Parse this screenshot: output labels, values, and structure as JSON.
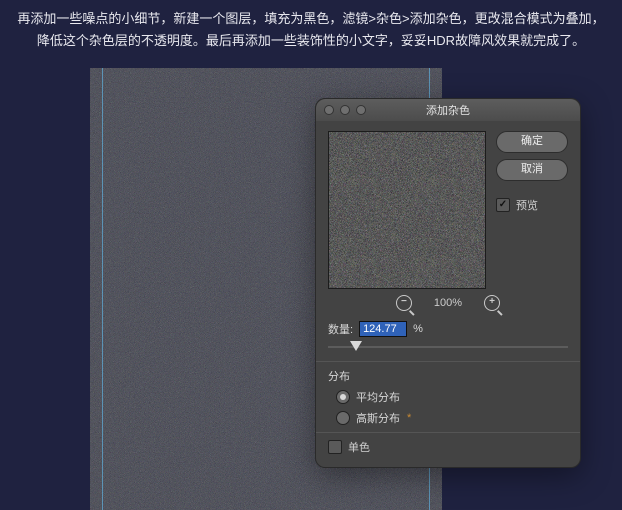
{
  "instructions": {
    "line1": "再添加一些噪点的小细节，新建一个图层，填充为黑色，滤镜>杂色>添加杂色，更改混合模式为叠加，",
    "line2": "降低这个杂色层的不透明度。最后再添加一些装饰性的小文字，妥妥HDR故障风效果就完成了。"
  },
  "dialog": {
    "title": "添加杂色",
    "ok_label": "确定",
    "cancel_label": "取消",
    "preview_label": "预览",
    "preview_checked": true,
    "zoom_value": "100%",
    "amount_label": "数量:",
    "amount_value": "124.77",
    "amount_unit": "%",
    "distribution_label": "分布",
    "radio_uniform_label": "平均分布",
    "radio_gaussian_label": "高斯分布",
    "distribution_selected": "uniform",
    "gaussian_asterisk": "*",
    "mono_label": "单色",
    "mono_checked": false
  }
}
